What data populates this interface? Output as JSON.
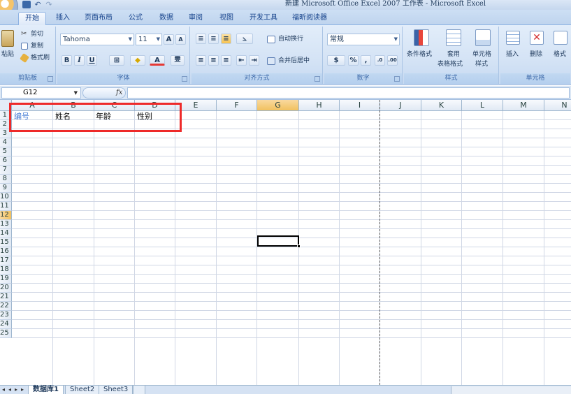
{
  "window": {
    "title": "新建 Microsoft Office Excel 2007 工作表 - Microsoft Excel"
  },
  "ribbon_tabs": [
    "开始",
    "插入",
    "页面布局",
    "公式",
    "数据",
    "审阅",
    "视图",
    "开发工具",
    "福昕阅读器"
  ],
  "active_tab": "开始",
  "clipboard": {
    "paste": "粘贴",
    "cut": "剪切",
    "copy": "复制",
    "format_painter": "格式刷",
    "label": "剪贴板"
  },
  "font": {
    "name": "Tahoma",
    "size": "11",
    "bold": "B",
    "italic": "I",
    "underline": "U",
    "grow": "A",
    "shrink": "A",
    "color": "A",
    "phonetic": "雯",
    "label": "字体"
  },
  "alignment": {
    "wrap": "自动换行",
    "merge": "合并后居中",
    "label": "对齐方式"
  },
  "number": {
    "format": "常规",
    "percent": "%",
    "comma": ",",
    "label": "数字"
  },
  "styles": {
    "conditional": "条件格式",
    "table_format_line1": "套用",
    "table_format_line2": "表格格式",
    "cell_styles_line1": "单元格",
    "cell_styles_line2": "样式",
    "label": "样式"
  },
  "cells": {
    "insert": "插入",
    "delete": "删除",
    "format": "格式",
    "label": "单元格"
  },
  "formula_bar": {
    "name_box": "G12",
    "fx": "fx",
    "value": ""
  },
  "columns": [
    "A",
    "B",
    "C",
    "D",
    "E",
    "F",
    "G",
    "H",
    "I",
    "J",
    "K",
    "L",
    "M",
    "N"
  ],
  "selected_column": "G",
  "selected_row": "12",
  "rows": [
    "1",
    "2",
    "3",
    "4",
    "5",
    "6",
    "7",
    "8",
    "9",
    "10",
    "11",
    "12",
    "13",
    "14",
    "15",
    "16",
    "17",
    "18",
    "19",
    "20",
    "21",
    "22",
    "23",
    "24",
    "25"
  ],
  "cells_data": {
    "A1": "编号",
    "B1": "姓名",
    "C1": "年龄",
    "D1": "性别"
  },
  "sheet_tabs": [
    "数据库1",
    "Sheet2",
    "Sheet3"
  ],
  "active_sheet": "数据库1",
  "colors": {
    "highlight_box": "#ee2a2a",
    "header_text_blue": "#4a7fd6",
    "selection": "#f1c15f"
  }
}
